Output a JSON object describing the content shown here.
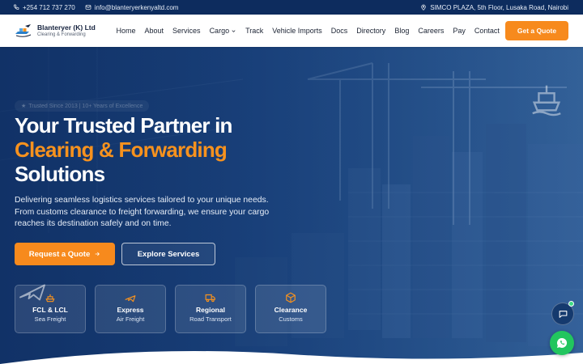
{
  "topbar": {
    "phone": "+254 712 737 270",
    "email": "info@blanteryerkenyaltd.com",
    "address": "SIMCO PLAZA, 5th Floor, Lusaka Road, Nairobi"
  },
  "brand": {
    "name": "Blanteryer (K) Ltd",
    "tagline": "Clearing & Forwarding"
  },
  "nav": {
    "items": [
      "Home",
      "About",
      "Services",
      "Cargo",
      "Track",
      "Vehicle Imports",
      "Docs",
      "Directory",
      "Blog",
      "Careers",
      "Pay",
      "Contact"
    ],
    "cta": "Get a Quote"
  },
  "hero": {
    "badge": "Trusted Since 2013 | 10+ Years of Excellence",
    "title_line1": "Your Trusted Partner in",
    "title_line2": "Clearing & Forwarding",
    "title_line3": "Solutions",
    "subtitle": "Delivering seamless logistics services tailored to your unique needs. From customs clearance to freight forwarding, we ensure your cargo reaches its destination safely and on time.",
    "primary_button": "Request a Quote",
    "secondary_button": "Explore Services"
  },
  "cards": [
    {
      "title": "FCL & LCL",
      "subtitle": "Sea Freight",
      "icon": "ship-icon"
    },
    {
      "title": "Express",
      "subtitle": "Air Freight",
      "icon": "plane-icon"
    },
    {
      "title": "Regional",
      "subtitle": "Road Transport",
      "icon": "truck-icon"
    },
    {
      "title": "Clearance",
      "subtitle": "Customs",
      "icon": "package-icon"
    }
  ],
  "colors": {
    "accent": "#f78a1d",
    "brand_dark": "#0d2c5e",
    "whatsapp": "#22c55e"
  }
}
